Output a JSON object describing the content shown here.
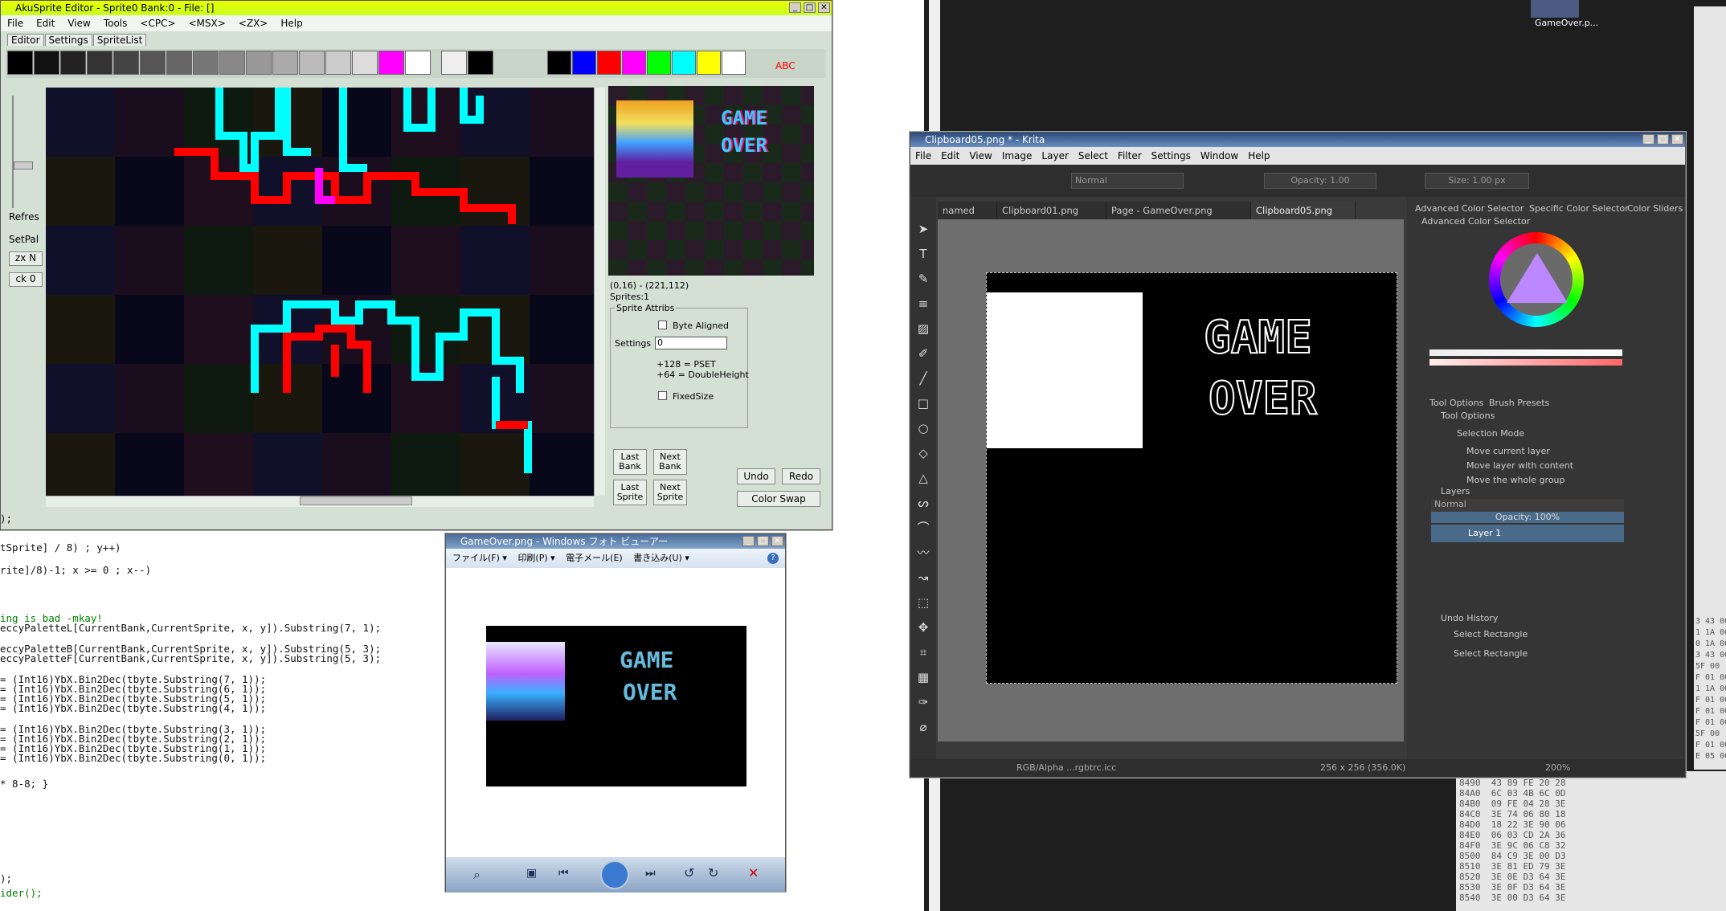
{
  "aku": {
    "title": "AkuSprite Editor - Sprite0  Bank:0 - File: []",
    "menu": [
      "File",
      "Edit",
      "View",
      "Tools",
      "<CPC>",
      "<MSX>",
      "<ZX>",
      "Help"
    ],
    "tabs": [
      "Editor",
      "Settings",
      "SpriteList"
    ],
    "side_buttons": [
      "Refres",
      "SetPal",
      "zx N",
      "ck 0"
    ],
    "coords": "(0,16) - (221,112)",
    "sprites": "Sprites:1",
    "attribs_title": "Sprite Attribs",
    "byte_aligned": "Byte Aligned",
    "settings_label": "Settings",
    "settings_value": "0",
    "help1": "+128 = PSET",
    "help2": "+64 = DoubleHeight",
    "fixed_size": "FixedSize",
    "last_bank": "Last Bank",
    "next_bank": "Next Bank",
    "last_sprite": "Last Sprite",
    "next_sprite": "Next Sprite",
    "undo": "Undo",
    "redo": "Redo",
    "color_swap": "Color Swap",
    "abc": "ABC",
    "preview_game": "GAME",
    "preview_over": "OVER"
  },
  "code": [
    {
      "t": ");",
      "c": "n"
    },
    {
      "t": "tSprite] / 8) ; y++)",
      "c": "n"
    },
    {
      "t": "rite]/8)-1; x >= 0 ; x--)",
      "c": "n"
    },
    {
      "t": "ing is bad -mkay!",
      "c": "cm"
    },
    {
      "t": "eccyPaletteL[CurrentBank,CurrentSprite, x, y]).Substring(7, 1);",
      "c": "n"
    },
    {
      "t": "eccyPaletteB[CurrentBank,CurrentSprite, x, y]).Substring(5, 3);",
      "c": "n"
    },
    {
      "t": "eccyPaletteF[CurrentBank,CurrentSprite, x, y]).Substring(5, 3);",
      "c": "n"
    },
    {
      "t": "= (Int16)YbX.Bin2Dec(tbyte.Substring(7, 1));",
      "c": "n"
    },
    {
      "t": "= (Int16)YbX.Bin2Dec(tbyte.Substring(6, 1));",
      "c": "n"
    },
    {
      "t": "= (Int16)YbX.Bin2Dec(tbyte.Substring(5, 1));",
      "c": "n"
    },
    {
      "t": "= (Int16)YbX.Bin2Dec(tbyte.Substring(4, 1));",
      "c": "n"
    },
    {
      "t": "= (Int16)YbX.Bin2Dec(tbyte.Substring(3, 1));",
      "c": "n"
    },
    {
      "t": "= (Int16)YbX.Bin2Dec(tbyte.Substring(2, 1));",
      "c": "n"
    },
    {
      "t": "= (Int16)YbX.Bin2Dec(tbyte.Substring(1, 1));",
      "c": "n"
    },
    {
      "t": "= (Int16)YbX.Bin2Dec(tbyte.Substring(0, 1));",
      "c": "n"
    },
    {
      "t": "* 8-8; }",
      "c": "n"
    },
    {
      "t": ");",
      "c": "n"
    },
    {
      "t": "ider();",
      "c": "cm"
    }
  ],
  "desktop_icon": "GameOver.p...",
  "viewer": {
    "title": "GameOver.png - Windows フォト ビューアー",
    "menu": [
      "ファイル(F) ▾",
      "印刷(P) ▾",
      "電子メール(E)",
      "書き込み(U) ▾"
    ],
    "game": "GAME",
    "over": "OVER"
  },
  "krita": {
    "title": "Clipboard05.png * - Krita",
    "menu": [
      "File",
      "Edit",
      "View",
      "Image",
      "Layer",
      "Select",
      "Filter",
      "Settings",
      "Window",
      "Help"
    ],
    "blend": "Normal",
    "opacity": "Opacity:  1.00",
    "size": "Size:  1.00 px",
    "tabs": [
      "named",
      "Clipboard01.png",
      "Page - GameOver.png",
      "Clipboard05.png"
    ],
    "canvas_game": "GAME",
    "canvas_over": "OVER",
    "status_left": "RGB/Alpha ...rgbtrc.icc",
    "status_mid": "256 x 256 (356.0K)",
    "zoom": "200%",
    "docker_tabs": [
      "Advanced Color Selector",
      "Specific Color Selector",
      "Color Sliders"
    ],
    "adv_color": "Advanced Color Selector",
    "tool_tabs": [
      "Tool Options",
      "Brush Presets"
    ],
    "tool_options": "Tool Options",
    "selection_mode": "Selection Mode",
    "opt1": "Move current layer",
    "opt2": "Move layer with content",
    "opt3": "Move the whole group",
    "layers": "Layers",
    "layer_blend": "Normal",
    "layer_opacity": "Opacity:  100%",
    "layer_name": "Layer 1",
    "undo_history": "Undo History",
    "undo1": "Select Rectangle",
    "undo2": "Select Rectangle"
  },
  "hex": [
    "8490  43 89 FE 20 28",
    "84A0  6C 03 4B 6C 0D",
    "84B0  09 FE 04 28 3E",
    "84C0  3E 74 06 80 18",
    "84D0  18 22 3E 90 06",
    "84E0  06 03 CD 2A 36",
    "84F0  3E 9C 06 C8 32",
    "8500  84 C9 3E 00 D3",
    "8510  3E 81 ED 79 3E",
    "8520  3E 0E D3 64 3E",
    "8530  3E 0F D3 64 3E",
    "8540  3E 00 D3 64 3E"
  ],
  "hex_right": [
    "3 43 00",
    "1 1A 00",
    "0 1A 00",
    "3 43 00",
    "5F 00",
    "F 01 00",
    "1 1A 00",
    "F 01 00",
    "F 01 00",
    "F 01 00",
    "5F 00",
    "F 01 00",
    "E 05 00"
  ]
}
